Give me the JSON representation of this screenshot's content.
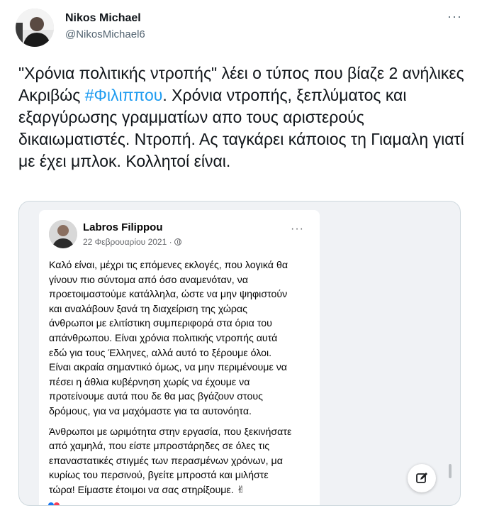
{
  "author": {
    "name": "Nikos Michael",
    "handle": "@NikosMichael6"
  },
  "more_label": "···",
  "tweet": {
    "text_before_hashtag": "\"Χρόνια πολιτικής ντροπής\" λέει ο τύπος που βίαζε 2 ανήλικες\nΑκριβώς ",
    "hashtag": "#Φιλιππου",
    "text_after_hashtag": ". Χρόνια ντροπής, ξεπλύματος και εξαργύρωσης γραμματίων απο τους αριστερούς δικαιωματιστές. Ντροπή. Ας ταγκάρει κάποιος τη Γιαμαλη γιατί με έχει μπλοκ. Κολλητοί είναι."
  },
  "embedded_post": {
    "author_name": "Labros Filippou",
    "date": "22 Φεβρουαρίου 2021 ·",
    "more_label": "···",
    "paragraph1_lines": [
      "Καλό είναι, μέχρι τις επόμενες εκλογές, που λογικά θα",
      "γίνουν πιο σύντομα από όσο αναμενόταν, να",
      "προετοιμαστούμε κατάλληλα, ώστε να μην ψηφιστούν",
      "και αναλάβουν ξανά τη διαχείριση της χώρας",
      "άνθρωποι με ελιτίστικη συμπεριφορά στα όρια του",
      "απάνθρωπου. Είναι χρόνια πολιτικής ντροπής αυτά",
      "εδώ για τους Έλληνες, αλλά αυτό το ξέρουμε όλοι.",
      "Είναι ακραία σημαντικό όμως, να μην περιμένουμε να",
      "πέσει η άθλια κυβέρνηση χωρίς να έχουμε να",
      "προτείνουμε αυτά που δε θα μας βγάζουν στους",
      "δρόμους, για να μαχόμαστε για τα αυτονόητα."
    ],
    "paragraph2_lines": [
      "Άνθρωποι με ωριμότητα στην εργασία, που ξεκινήσατε",
      "από χαμηλά, που είστε μπροστάρηδες σε όλες τις",
      "επαναστατικές στιγμές των περασμένων χρόνων, μα",
      "κυρίως του περσινού, βγείτε μπροστά και μιλήστε",
      "τώρα! Είμαστε έτοιμοι να σας στηρίξουμε. ✌"
    ]
  },
  "colors": {
    "link": "#1d9bf0",
    "secondary_text": "#536471",
    "fb_background": "#f0f2f5"
  },
  "icons": {
    "more": "more-horizontal-icon",
    "globe": "globe-icon",
    "edit": "edit-compose-icon"
  }
}
